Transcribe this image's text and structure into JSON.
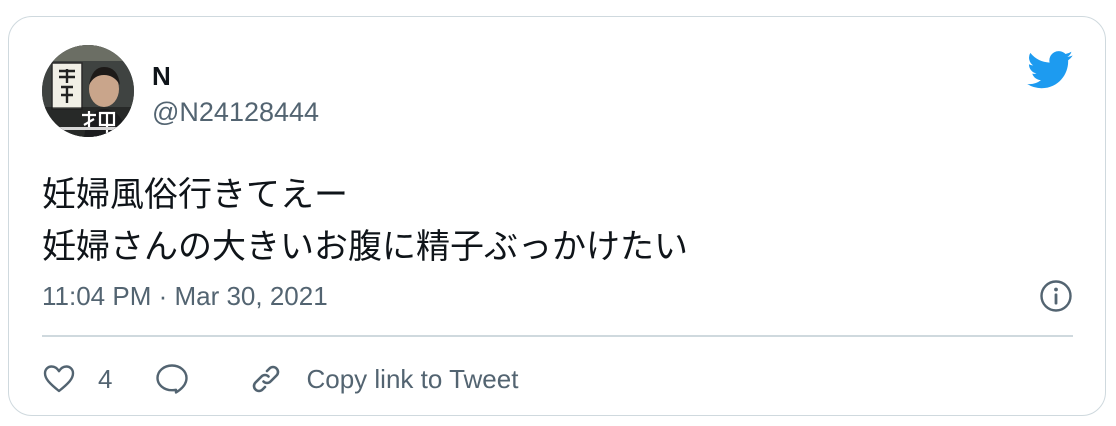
{
  "author": {
    "name": "N",
    "handle": "@N24128444"
  },
  "tweet": {
    "text": "妊婦風俗行きてえー\n妊婦さんの大きいお腹に精子ぶっかけたい",
    "timestamp": "11:04 PM · Mar 30, 2021"
  },
  "actions": {
    "like_count": "4",
    "copy_link_label": "Copy link to Tweet"
  },
  "icons": {
    "brand": "twitter-bird-icon",
    "info": "info-icon",
    "like": "heart-icon",
    "reply": "speech-bubble-icon",
    "copy": "link-icon"
  },
  "colors": {
    "brand": "#1d9bf0",
    "text": "#0f1419",
    "secondary": "#536471",
    "border": "#cfd9de"
  }
}
